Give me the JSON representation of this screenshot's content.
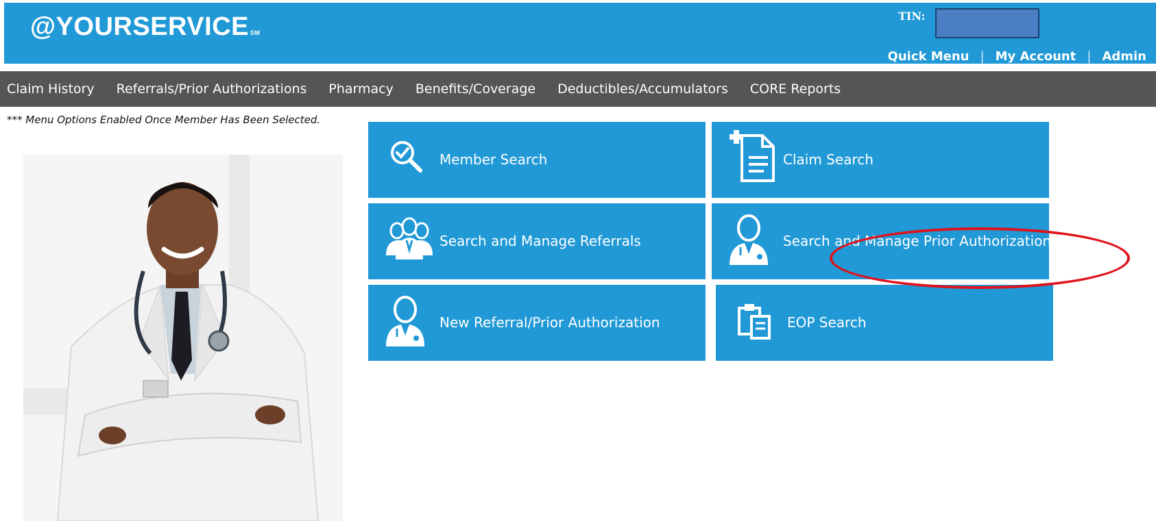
{
  "header": {
    "logo": "@YOURSERVICE",
    "logo_mark": "SM",
    "tin_label": "TIN:",
    "tin_value": "",
    "topnav": [
      "Quick Menu",
      "My Account",
      "Admin"
    ]
  },
  "menu": {
    "items": [
      "Claim History",
      "Referrals/Prior Authorizations",
      "Pharmacy",
      "Benefits/Coverage",
      "Deductibles/Accumulators",
      "CORE Reports"
    ]
  },
  "note": "*** Menu Options Enabled Once Member Has Been Selected.",
  "tiles": [
    {
      "label": "Member Search",
      "icon": "search-check-icon"
    },
    {
      "label": "Claim Search",
      "icon": "document-plus-icon"
    },
    {
      "label": "Search and Manage Referrals",
      "icon": "group-doctors-icon"
    },
    {
      "label": "Search and Manage Prior Authorizations",
      "icon": "doctor-icon"
    },
    {
      "label": "New Referral/Prior Authorization",
      "icon": "doctor-icon"
    },
    {
      "label": "EOP Search",
      "icon": "clipboard-documents-icon"
    }
  ],
  "colors": {
    "brand_blue": "#2199d6",
    "menu_gray": "#555558",
    "highlight_red": "#e0121b"
  }
}
